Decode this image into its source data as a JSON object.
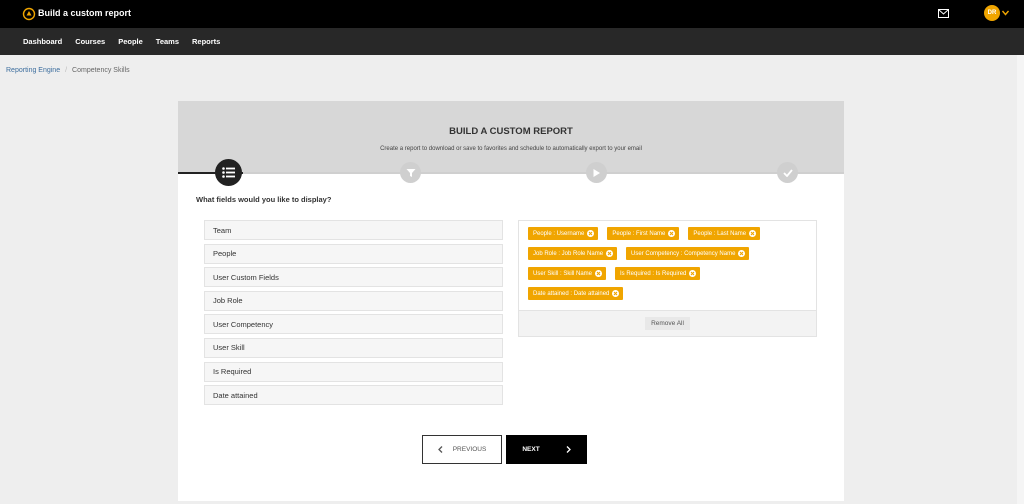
{
  "header": {
    "title": "Build a custom report",
    "avatar_initials": "DR",
    "accent_color": "#f0a500"
  },
  "nav": {
    "items": [
      "Dashboard",
      "Courses",
      "People",
      "Teams",
      "Reports"
    ]
  },
  "breadcrumb": {
    "root": "Reporting Engine",
    "separator": "/",
    "current": "Competency Skills"
  },
  "card": {
    "title": "BUILD A CUSTOM REPORT",
    "subtitle": "Create a report to download or save to favorites and schedule to automatically export to your email",
    "steps": [
      "list-icon",
      "filter-icon",
      "play-icon",
      "check-icon"
    ],
    "active_step": 1,
    "question": "What fields would you like to display?"
  },
  "fields": [
    "Team",
    "People",
    "User Custom Fields",
    "Job Role",
    "User Competency",
    "User Skill",
    "Is Required",
    "Date attained"
  ],
  "selected_tags": [
    "People : Username",
    "People : First Name",
    "People : Last Name",
    "Job Role : Job Role Name",
    "User Competency : Competency Name",
    "User Skill : Skill Name",
    "Is Required : Is Required",
    "Date attained : Date attained"
  ],
  "actions": {
    "remove_all": "Remove All",
    "previous": "PREVIOUS",
    "next": "NEXT"
  }
}
